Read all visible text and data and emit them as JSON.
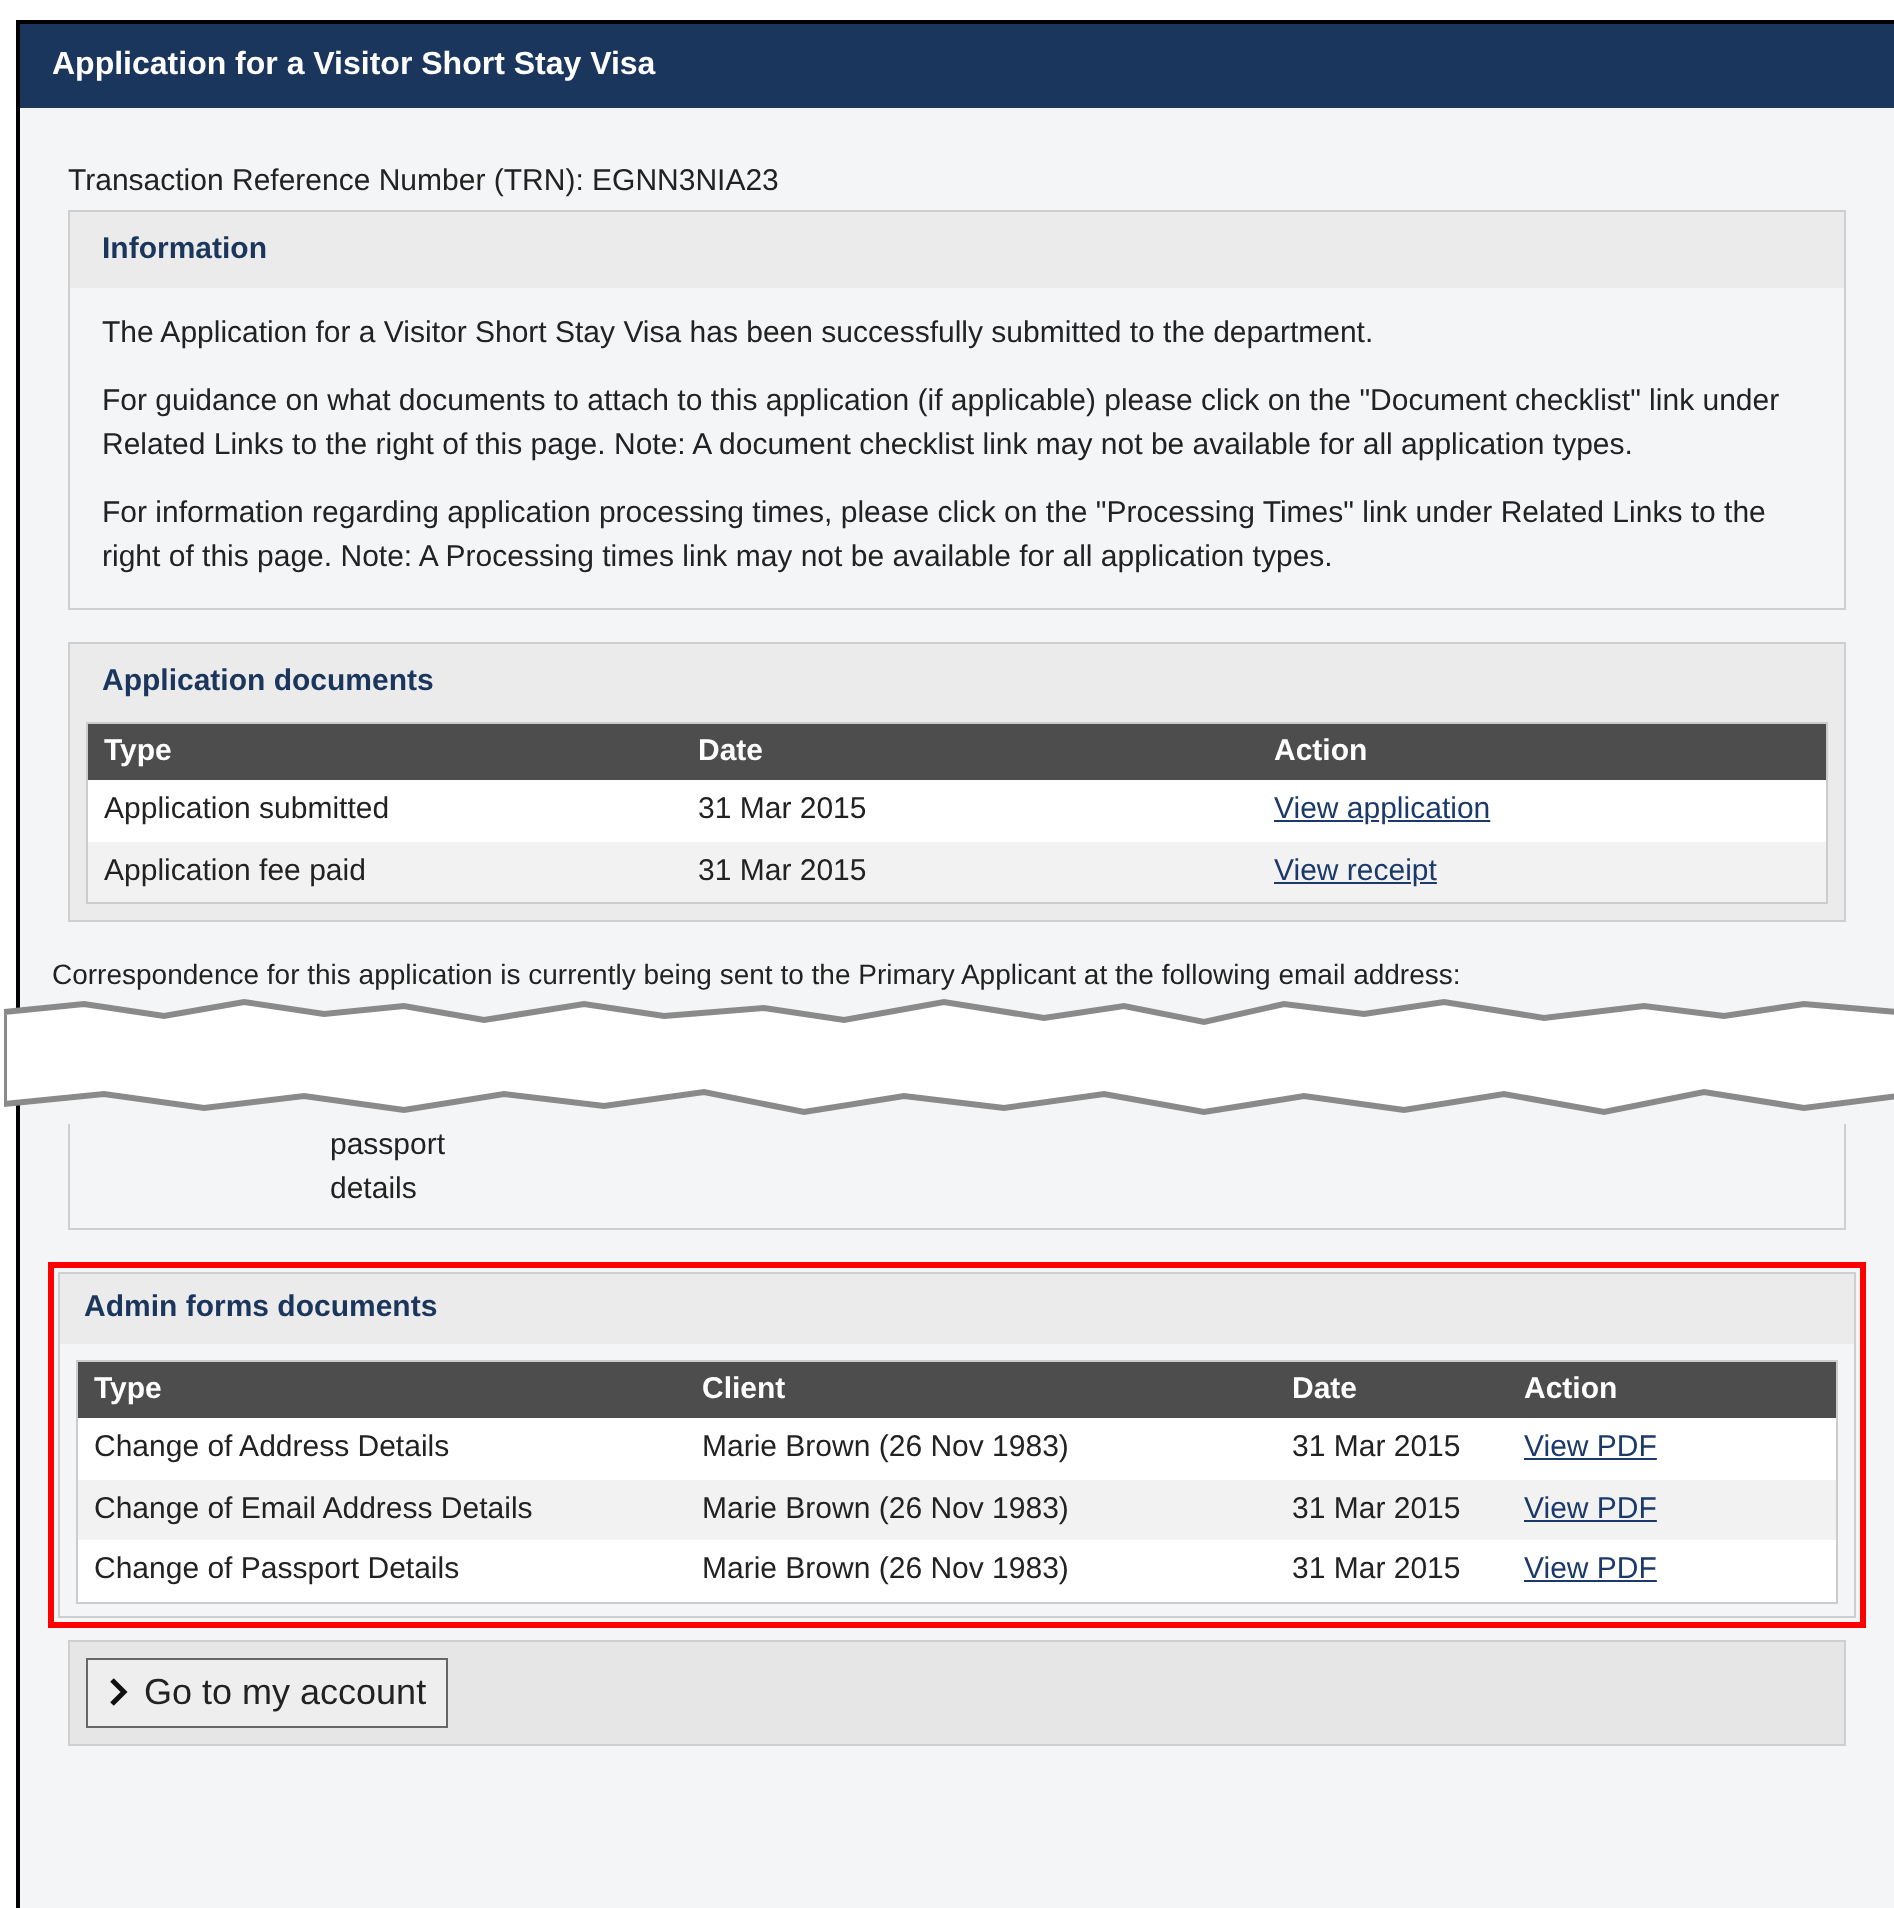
{
  "window": {
    "title": "Application for a Visitor Short Stay Visa"
  },
  "trn": "Transaction Reference Number (TRN): EGNN3NIA23",
  "information": {
    "title": "Information",
    "paragraphs": [
      "The Application for a Visitor Short Stay Visa has been successfully submitted to the department.",
      "For guidance on what documents to attach to this application (if applicable) please click on the \"Document checklist\" link under Related Links to the right of this page. Note: A document checklist link may not be available for all application types.",
      "For information regarding application processing times, please click on the \"Processing Times\" link under Related Links to the right of this page. Note: A Processing times link may not be available for all application types."
    ]
  },
  "application_documents": {
    "title": "Application documents",
    "columns": [
      "Type",
      "Date",
      "Action"
    ],
    "rows": [
      {
        "type": "Application submitted",
        "date": "31 Mar 2015",
        "action": "View application"
      },
      {
        "type": "Application fee paid",
        "date": "31 Mar 2015",
        "action": "View receipt"
      }
    ]
  },
  "correspondence": "Correspondence for this application is currently being sent to the Primary Applicant at the following email address:",
  "fragment": [
    "passport",
    "details"
  ],
  "admin_forms": {
    "title": "Admin forms documents",
    "highlighted": true,
    "columns": [
      "Type",
      "Client",
      "Date",
      "Action"
    ],
    "rows": [
      {
        "type": "Change of Address Details",
        "client": "Marie Brown (26 Nov 1983)",
        "date": "31 Mar 2015",
        "action": "View PDF"
      },
      {
        "type": "Change of Email Address Details",
        "client": "Marie Brown (26 Nov 1983)",
        "date": "31 Mar 2015",
        "action": "View PDF"
      },
      {
        "type": "Change of Passport Details",
        "client": "Marie Brown (26 Nov 1983)",
        "date": "31 Mar 2015",
        "action": "View PDF"
      }
    ]
  },
  "account_button": {
    "label": "Go to my account"
  }
}
